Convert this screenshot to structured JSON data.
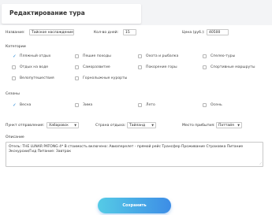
{
  "header": {
    "title": "Редактирование тура"
  },
  "fields": {
    "name": {
      "label": "Название:",
      "value": "Тайское наслаждение"
    },
    "days": {
      "label": "Кол-во дней:",
      "value": "15"
    },
    "price": {
      "label": "Цена (руб.):",
      "value": "40500"
    }
  },
  "categories": {
    "title": "Категории",
    "items": [
      {
        "label": "Пляжный отдых",
        "checked": true
      },
      {
        "label": "Пешие походы",
        "checked": false
      },
      {
        "label": "Охота и рыбалка",
        "checked": false
      },
      {
        "label": "Спелео-туры",
        "checked": false
      },
      {
        "label": "Отдых на воде",
        "checked": false
      },
      {
        "label": "Самоpазвитие",
        "checked": false
      },
      {
        "label": "Покорение горы",
        "checked": false
      },
      {
        "label": "Спортивные маршруты",
        "checked": false
      },
      {
        "label": "Велопутешествия",
        "checked": false
      },
      {
        "label": "Горнолыжные курорты",
        "checked": false
      }
    ]
  },
  "seasons": {
    "title": "Сезоны",
    "items": [
      {
        "label": "Весна",
        "checked": true
      },
      {
        "label": "Зима",
        "checked": false
      },
      {
        "label": "Лето",
        "checked": false
      },
      {
        "label": "Осень",
        "checked": false
      }
    ]
  },
  "route": {
    "departure": {
      "label": "Пункт отправления:",
      "value": "Хабаровск"
    },
    "country": {
      "label": "Страна отдыха:",
      "value": "Тайланд"
    },
    "arrival": {
      "label": "Место прибытия:",
      "value": "Паттайя"
    }
  },
  "description": {
    "label": "Описание",
    "text": "Отель: THE LUNAR PATONG 4* В стоимость включено: Авиаперелет - прямой рейс Трансфер Проживание Страховка Питание Экскурсии/Гид Питание: Завтрак"
  },
  "actions": {
    "save_label": "Сохранить"
  },
  "colors": {
    "accent": "#2a8bd6",
    "button_start": "#55cbe6",
    "button_end": "#3d8de6"
  }
}
